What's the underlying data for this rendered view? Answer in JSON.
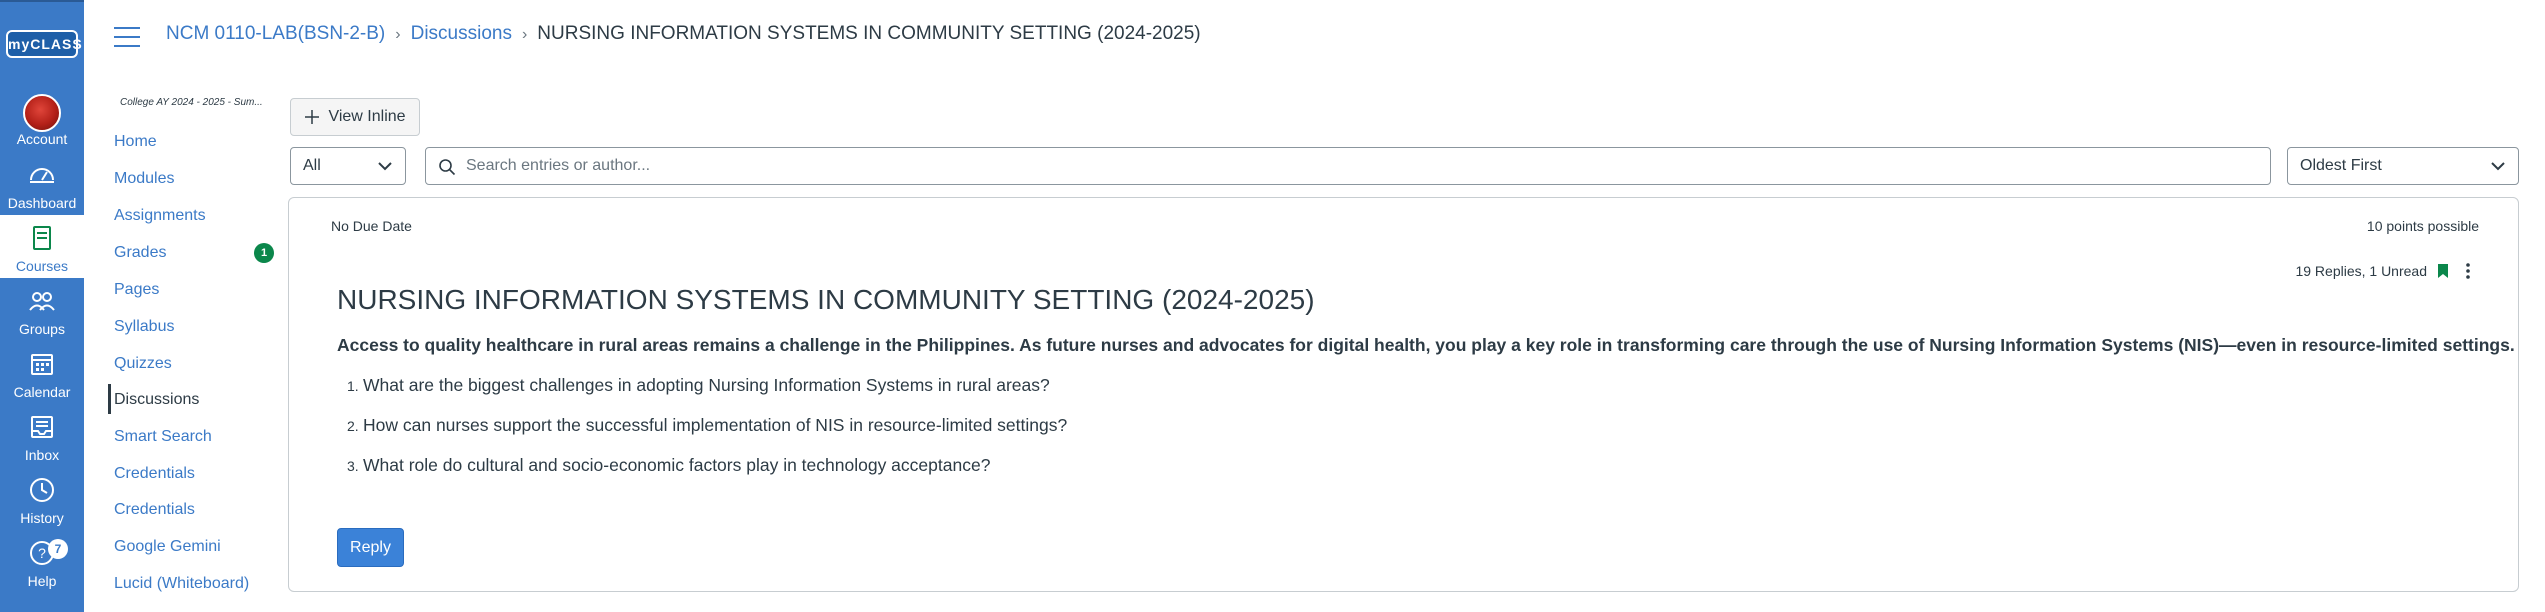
{
  "global_nav": {
    "logo": "myCLASS",
    "items": [
      {
        "label": "Account",
        "icon": "avatar"
      },
      {
        "label": "Dashboard",
        "icon": "dashboard-icon"
      },
      {
        "label": "Courses",
        "icon": "courses-icon"
      },
      {
        "label": "Groups",
        "icon": "groups-icon"
      },
      {
        "label": "Calendar",
        "icon": "calendar-icon"
      },
      {
        "label": "Inbox",
        "icon": "inbox-icon"
      },
      {
        "label": "History",
        "icon": "history-icon"
      },
      {
        "label": "Help",
        "icon": "help-icon",
        "badge": "7"
      }
    ],
    "nav_color": "#3b7ac7"
  },
  "breadcrumb": {
    "course": "NCM 0110-LAB(BSN-2-B)",
    "section": "Discussions",
    "current": "NURSING INFORMATION SYSTEMS IN COMMUNITY SETTING (2024-2025)"
  },
  "course_nav": {
    "term": "College AY 2024 - 2025 - Sum...",
    "items": [
      {
        "label": "Home"
      },
      {
        "label": "Modules"
      },
      {
        "label": "Assignments"
      },
      {
        "label": "Grades",
        "badge": "1"
      },
      {
        "label": "Pages"
      },
      {
        "label": "Syllabus"
      },
      {
        "label": "Quizzes"
      },
      {
        "label": "Discussions",
        "active": true
      },
      {
        "label": "Smart Search"
      },
      {
        "label": "Credentials"
      },
      {
        "label": "Credentials"
      },
      {
        "label": "Google Gemini"
      },
      {
        "label": "Lucid (Whiteboard)"
      }
    ]
  },
  "toolbar": {
    "view_inline_label": "View Inline",
    "filter_value": "All",
    "search_placeholder": "Search entries or author...",
    "sort_value": "Oldest First"
  },
  "discussion": {
    "due_date": "No Due Date",
    "points": "10 points possible",
    "replies": "19 Replies, 1 Unread",
    "title": "NURSING INFORMATION SYSTEMS IN COMMUNITY SETTING (2024-2025)",
    "intro": "Access to quality healthcare in rural areas remains a challenge in the Philippines. As future nurses and advocates for digital health, you play a key role in transforming care through the use of Nursing Information Systems (NIS)—even in resource-limited settings.",
    "questions": [
      {
        "num": "1.",
        "text": "What are the biggest challenges in adopting Nursing Information Systems in rural areas?"
      },
      {
        "num": "2.",
        "text": "How can nurses support the successful implementation of NIS in resource-limited settings?"
      },
      {
        "num": "3.",
        "text": "What role do cultural and socio-economic factors play in technology acceptance?"
      }
    ],
    "reply_label": "Reply",
    "bookmark_color": "#0b874b"
  }
}
